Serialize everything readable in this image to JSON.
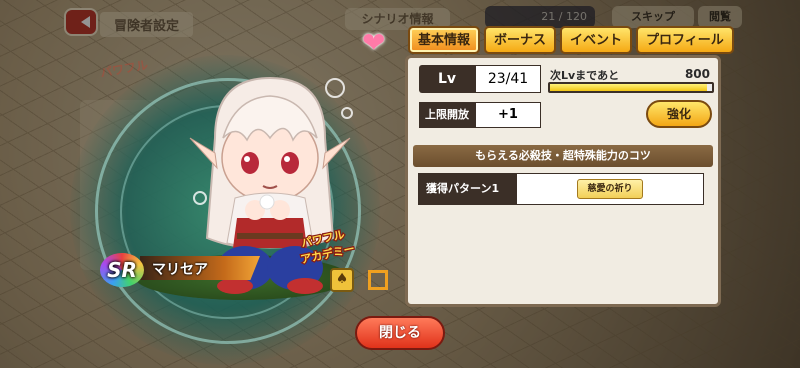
{
  "header": {
    "title": "冒険者設定",
    "scenario_tab": "シナリオ情報",
    "counter": "21 / 120",
    "skip_label": "スキップ",
    "log_label": "閲覧"
  },
  "character": {
    "rarity": "SR",
    "name": "マリセア",
    "brand_line1": "パワフル",
    "brand_line2": "アカデミー"
  },
  "tabs": [
    {
      "label": "基本情報",
      "active": true
    },
    {
      "label": "ボーナス",
      "active": false
    },
    {
      "label": "イベント",
      "active": false
    },
    {
      "label": "プロフィール",
      "active": false
    }
  ],
  "stats": {
    "lv_label": "Lv",
    "lv_value": "23/41",
    "next_lv_label": "次Lvまであと",
    "next_lv_value": "800",
    "exp_progress": 0.97,
    "limit_label": "上限開放",
    "limit_value": "+1",
    "enhance_label": "強化"
  },
  "skills": {
    "section_title": "もらえる必殺技・超特殊能力のコツ",
    "pattern_label": "獲得パターン1",
    "skill_name": "慈愛の祈り"
  },
  "footer": {
    "close_label": "閉じる"
  },
  "colors": {
    "tab_yellow": "#f5a914",
    "close_red": "#e0321a",
    "panel_bg": "#f1ece2"
  }
}
